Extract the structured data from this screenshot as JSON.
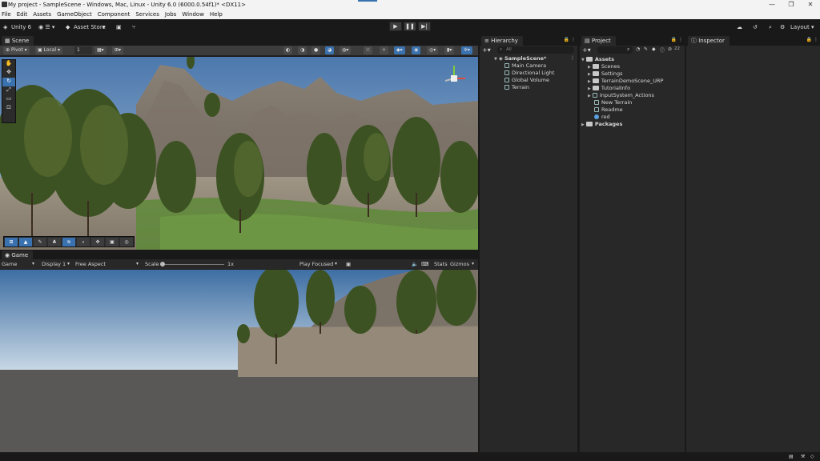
{
  "window": {
    "title": "My project - SampleScene - Windows, Mac, Linux - Unity 6.0 (6000.0.54f1)* <DX11>",
    "controls": [
      "—",
      "❐",
      "✕"
    ]
  },
  "menu": [
    "File",
    "Edit",
    "Assets",
    "GameObject",
    "Component",
    "Services",
    "Jobs",
    "Window",
    "Help"
  ],
  "toolbar": {
    "unity_label": "Unity 6",
    "asset_store": "Asset Store",
    "layout": "Layout",
    "play": "▶",
    "pause": "❚❚",
    "step": "▶|"
  },
  "scene": {
    "tab": "Scene",
    "pivot": "Pivot",
    "local": "Local",
    "grid_value": "1"
  },
  "game": {
    "tab": "Game",
    "mode": "Game",
    "display": "Display 1",
    "aspect": "Free Aspect",
    "scale_label": "Scale",
    "scale_value": "1x",
    "play_focused": "Play Focused",
    "stats": "Stats",
    "gizmos": "Gizmos"
  },
  "hierarchy": {
    "tab": "Hierarchy",
    "search_placeholder": "All",
    "scene_name": "SampleScene*",
    "items": [
      "Main Camera",
      "Directional Light",
      "Global Volume",
      "Terrain"
    ]
  },
  "project": {
    "tab": "Project",
    "root": "Assets",
    "items": [
      "Scenes",
      "Settings",
      "TerrainDemoScene_URP",
      "TutorialInfo",
      "InputSystem_Actions",
      "New Terrain",
      "Readme",
      "red"
    ],
    "packages": "Packages",
    "count": "22"
  },
  "inspector": {
    "tab": "Inspector"
  },
  "colors": {
    "accent": "#3a72b0",
    "panel": "#282828",
    "bg": "#191919"
  }
}
